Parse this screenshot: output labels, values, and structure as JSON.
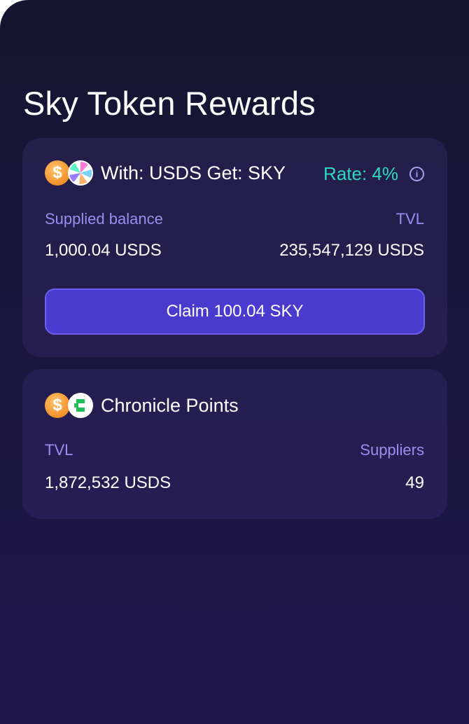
{
  "page": {
    "title": "Sky Token Rewards"
  },
  "sky_card": {
    "icons": [
      "usds-coin-icon",
      "sky-token-icon",
      "info-icon"
    ],
    "title": "With: USDS Get: SKY",
    "rate": "Rate: 4%",
    "supplied_label": "Supplied balance",
    "supplied_value": "1,000.04 USDS",
    "tvl_label": "TVL",
    "tvl_value": "235,547,129 USDS",
    "claim_label": "Claim 100.04 SKY",
    "colors": {
      "rate": "#2fd9be",
      "button": "#4a3bcf",
      "label": "#9a8ff0"
    }
  },
  "chronicle_card": {
    "icons": [
      "usds-coin-icon",
      "chronicle-icon"
    ],
    "title": "Chronicle Points",
    "tvl_label": "TVL",
    "tvl_value": "1,872,532 USDS",
    "suppliers_label": "Suppliers",
    "suppliers_value": "49"
  }
}
